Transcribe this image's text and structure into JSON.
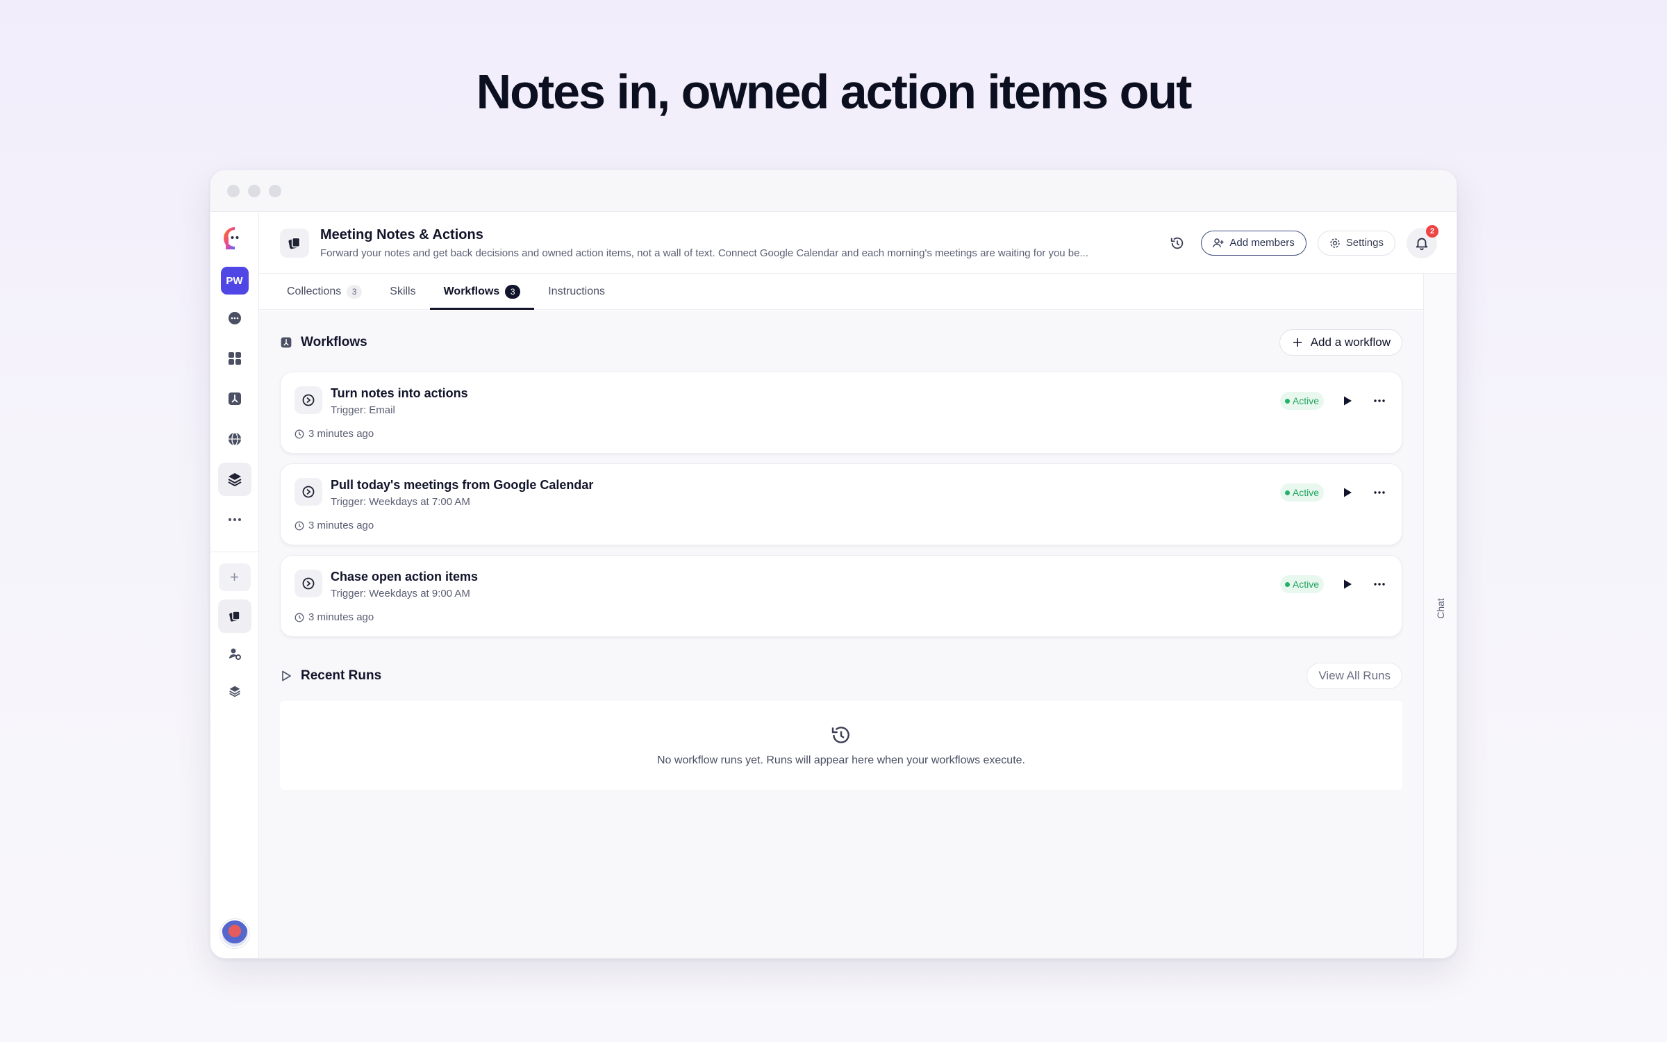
{
  "hero": {
    "title": "Notes in, owned action items out"
  },
  "rail": {
    "workspace_initials": "PW"
  },
  "header": {
    "title": "Meeting Notes & Actions",
    "description": "Forward your notes and get back decisions and owned action items, not a wall of text. Connect Google Calendar and each morning's meetings are waiting for you be...",
    "add_members_label": "Add members",
    "settings_label": "Settings",
    "notification_count": "2"
  },
  "tabs": [
    {
      "label": "Collections",
      "count": "3",
      "active": false
    },
    {
      "label": "Skills",
      "count": "",
      "active": false
    },
    {
      "label": "Workflows",
      "count": "3",
      "active": true
    },
    {
      "label": "Instructions",
      "count": "",
      "active": false
    }
  ],
  "workflows": {
    "title": "Workflows",
    "add_label": "Add a workflow",
    "items": [
      {
        "name": "Turn notes into actions",
        "trigger": "Trigger: Email",
        "time": "3 minutes ago",
        "status": "Active"
      },
      {
        "name": "Pull today's meetings from Google Calendar",
        "trigger": "Trigger: Weekdays at 7:00 AM",
        "time": "3 minutes ago",
        "status": "Active"
      },
      {
        "name": "Chase open action items",
        "trigger": "Trigger: Weekdays at 9:00 AM",
        "time": "3 minutes ago",
        "status": "Active"
      }
    ]
  },
  "runs": {
    "title": "Recent Runs",
    "view_all_label": "View All Runs",
    "empty_text": "No workflow runs yet. Runs will appear here when your workflows execute."
  },
  "chat": {
    "label": "Chat"
  },
  "colors": {
    "accent": "#4f46e5",
    "active_green": "#20a560",
    "badge_red": "#ef4444",
    "text_dark": "#11142a"
  }
}
